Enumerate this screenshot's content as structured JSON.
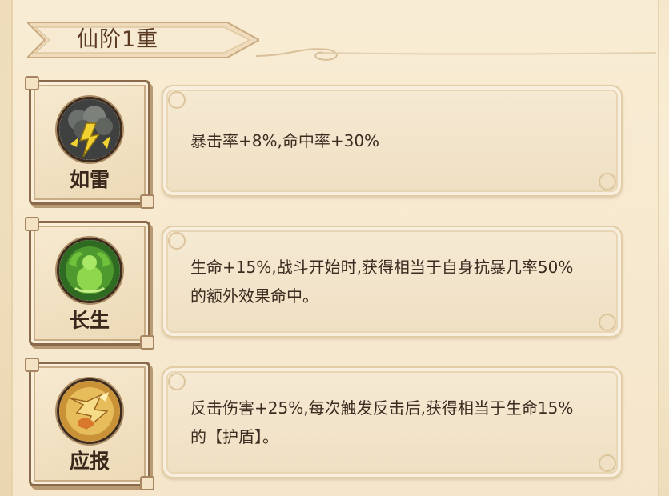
{
  "header": {
    "title": "仙阶1重"
  },
  "skills": [
    {
      "name": "如雷",
      "icon": "thunder-cloud-icon",
      "description": "暴击率+8%,命中率+30%",
      "accent": "#f1d230"
    },
    {
      "name": "长生",
      "icon": "green-spirit-icon",
      "description": "生命+15%,战斗开始时,获得相当于自身抗暴几率50%的额外效果命中。",
      "accent": "#6fc13c"
    },
    {
      "name": "应报",
      "icon": "counter-strike-icon",
      "description": "反击伤害+25%,每次触发反击后,获得相当于生命15%的【护盾】。",
      "accent": "#e0a43c"
    }
  ]
}
